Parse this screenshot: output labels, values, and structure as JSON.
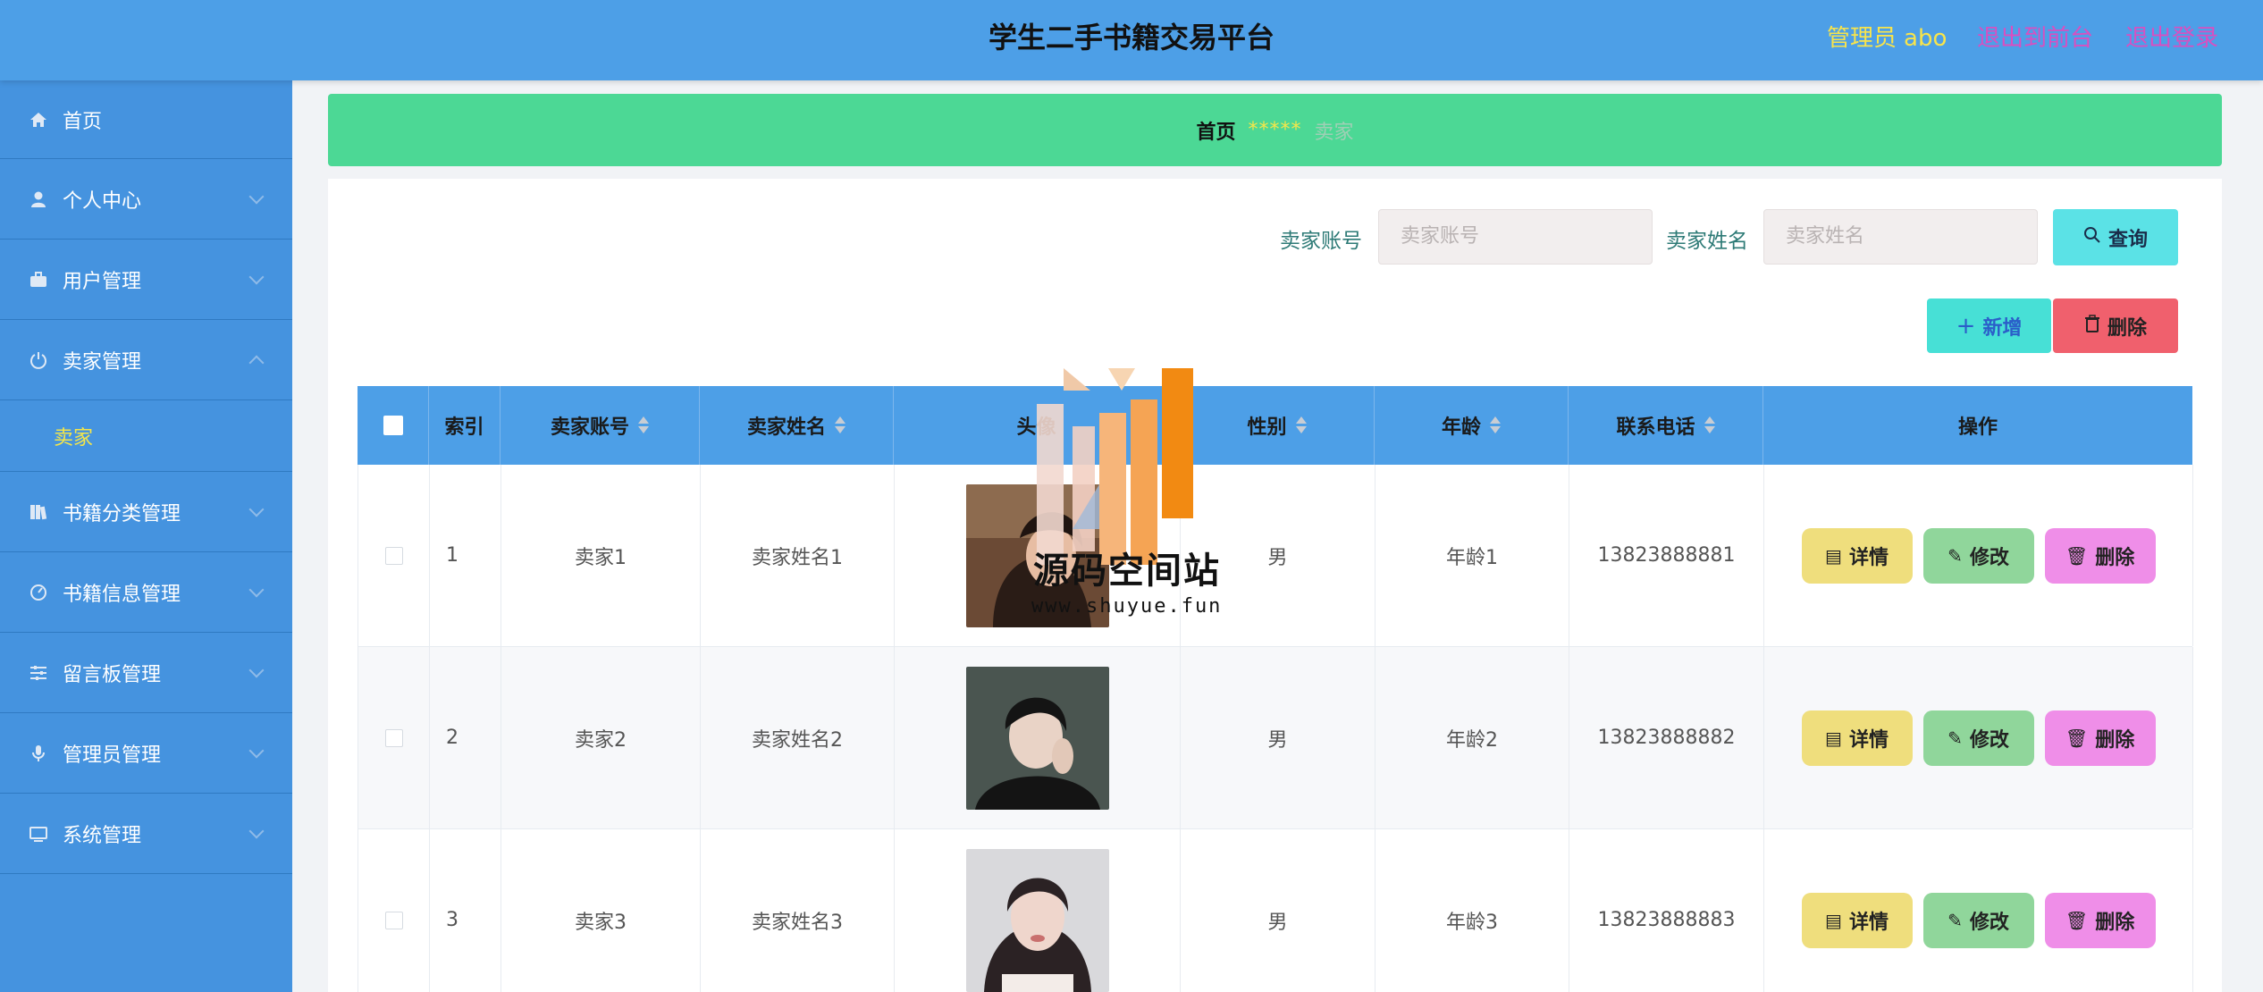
{
  "header": {
    "title": "学生二手书籍交易平台",
    "admin_role": "管理员",
    "admin_name": "abo",
    "to_front": "退出到前台",
    "logout": "退出登录"
  },
  "sidebar": {
    "items": [
      {
        "label": "首页",
        "icon": "home-icon"
      },
      {
        "label": "个人中心",
        "icon": "user-icon"
      },
      {
        "label": "用户管理",
        "icon": "briefcase-icon"
      },
      {
        "label": "卖家管理",
        "icon": "power-icon"
      },
      {
        "label": "书籍分类管理",
        "icon": "books-icon"
      },
      {
        "label": "书籍信息管理",
        "icon": "dashboard-icon"
      },
      {
        "label": "留言板管理",
        "icon": "sliders-icon"
      },
      {
        "label": "管理员管理",
        "icon": "microphone-icon"
      },
      {
        "label": "系统管理",
        "icon": "monitor-icon"
      }
    ],
    "submenu_seller": "卖家"
  },
  "breadcrumb": {
    "home": "首页",
    "separator": "*****",
    "current": "卖家"
  },
  "search": {
    "account_label": "卖家账号",
    "account_placeholder": "卖家账号",
    "name_label": "卖家姓名",
    "name_placeholder": "卖家姓名",
    "query_button": "查询"
  },
  "actions": {
    "add_button": "新增",
    "delete_button": "删除"
  },
  "table": {
    "columns": [
      "索引",
      "卖家账号",
      "卖家姓名",
      "头像",
      "性别",
      "年龄",
      "联系电话",
      "操作"
    ],
    "rows": [
      {
        "index": "1",
        "account": "卖家1",
        "name": "卖家姓名1",
        "gender": "男",
        "age": "年龄1",
        "phone": "13823888881"
      },
      {
        "index": "2",
        "account": "卖家2",
        "name": "卖家姓名2",
        "gender": "男",
        "age": "年龄2",
        "phone": "13823888882"
      },
      {
        "index": "3",
        "account": "卖家3",
        "name": "卖家姓名3",
        "gender": "男",
        "age": "年龄3",
        "phone": "13823888883"
      }
    ],
    "row_actions": {
      "detail": "详情",
      "edit": "修改",
      "delete": "删除"
    }
  },
  "watermark": {
    "text": "源码空间站",
    "url": "www.shuyue.fun"
  },
  "colors": {
    "header_bg": "#4d9fe7",
    "sidebar_bg": "#4593df",
    "breadcrumb_bg": "#4cd895",
    "accent_yellow": "#f4e64a",
    "accent_pink": "#d94fc0"
  }
}
